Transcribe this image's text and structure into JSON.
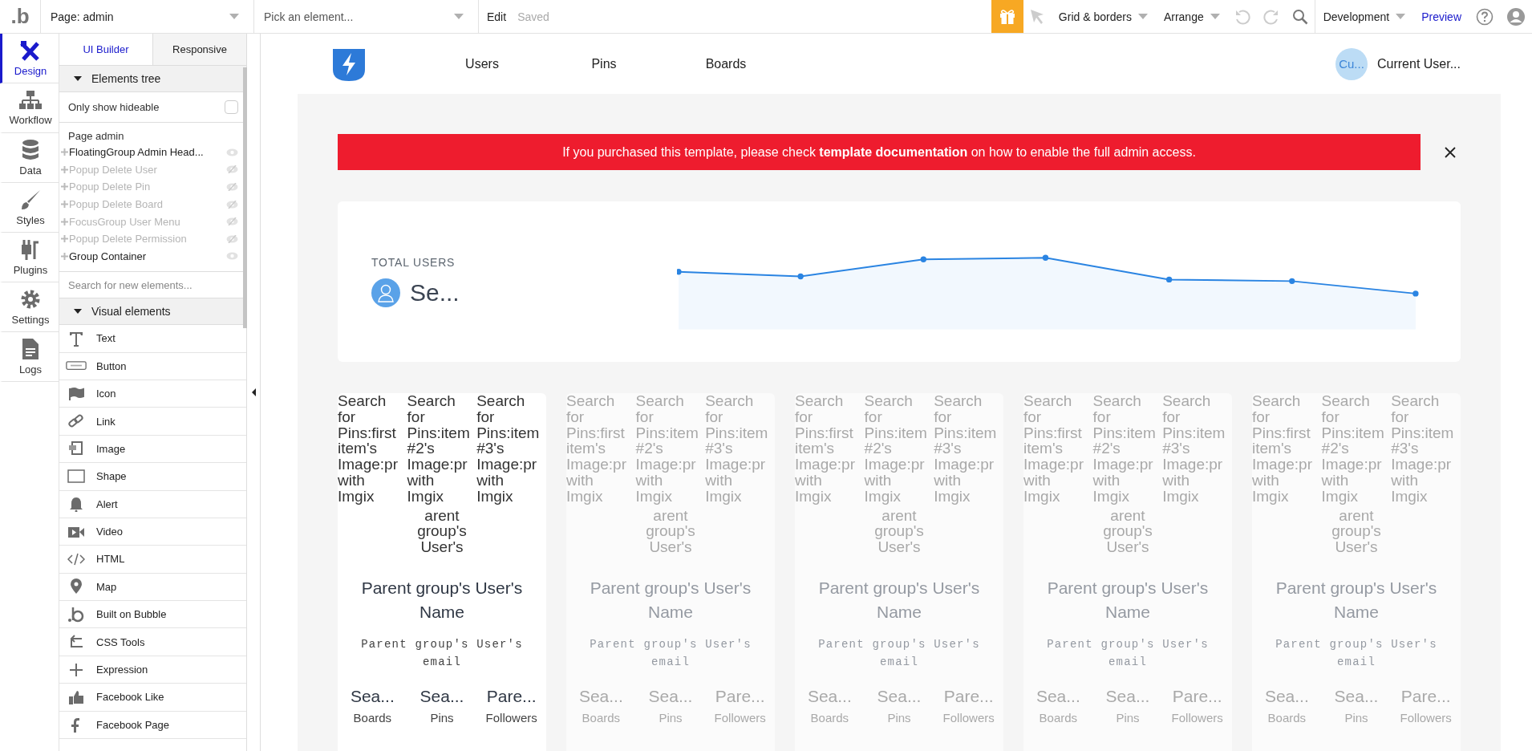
{
  "topbar": {
    "logo": ".b",
    "page_select": "Page: admin",
    "element_select": {
      "placeholder": "Pick an element..."
    },
    "edit": "Edit",
    "status": "Saved",
    "grid": "Grid & borders",
    "arrange": "Arrange",
    "mode": "Development",
    "preview": "Preview"
  },
  "rail": [
    {
      "label": "Design",
      "kind": "design",
      "selected": true
    },
    {
      "label": "Workflow",
      "kind": "workflow",
      "selected": false
    },
    {
      "label": "Data",
      "kind": "data",
      "selected": false
    },
    {
      "label": "Styles",
      "kind": "styles",
      "selected": false
    },
    {
      "label": "Plugins",
      "kind": "plugins",
      "selected": false
    },
    {
      "label": "Settings",
      "kind": "settings",
      "selected": false
    },
    {
      "label": "Logs",
      "kind": "logs",
      "selected": false
    }
  ],
  "panel_tabs": [
    {
      "label": "UI Builder",
      "selected": true
    },
    {
      "label": "Responsive",
      "selected": false
    }
  ],
  "elements_tree": {
    "title": "Elements tree",
    "expanded": true,
    "only_hideable": {
      "label": "Only show hideable",
      "checked": false
    },
    "root": "Page admin",
    "items": [
      {
        "label": "FloatingGroup Admin Head...",
        "visible": true
      },
      {
        "label": "Popup Delete User",
        "visible": false
      },
      {
        "label": "Popup Delete Pin",
        "visible": false
      },
      {
        "label": "Popup Delete Board",
        "visible": false
      },
      {
        "label": "FocusGroup User Menu",
        "visible": false
      },
      {
        "label": "Popup Delete Permission",
        "visible": false
      },
      {
        "label": "Group Container",
        "visible": true
      }
    ]
  },
  "search": {
    "placeholder": "Search for new elements..."
  },
  "visual_elements": {
    "title": "Visual elements",
    "expanded": true,
    "items": [
      {
        "label": "Text",
        "kind": "text"
      },
      {
        "label": "Button",
        "kind": "button"
      },
      {
        "label": "Icon",
        "kind": "icon"
      },
      {
        "label": "Link",
        "kind": "link"
      },
      {
        "label": "Image",
        "kind": "image"
      },
      {
        "label": "Shape",
        "kind": "shape"
      },
      {
        "label": "Alert",
        "kind": "alert"
      },
      {
        "label": "Video",
        "kind": "video"
      },
      {
        "label": "HTML",
        "kind": "html"
      },
      {
        "label": "Map",
        "kind": "map"
      },
      {
        "label": "Built on Bubble",
        "kind": "bubble"
      },
      {
        "label": "CSS Tools",
        "kind": "css"
      },
      {
        "label": "Expression",
        "kind": "expression"
      },
      {
        "label": "Facebook Like",
        "kind": "like"
      },
      {
        "label": "Facebook Page",
        "kind": "facebook"
      }
    ]
  },
  "page": {
    "nav": [
      "Users",
      "Pins",
      "Boards"
    ],
    "user": {
      "avatar": "Cu...",
      "name": "Current User..."
    },
    "banner": {
      "text": "If you purchased this template, please check **template documentation** on how to enable the full admin access."
    },
    "stat": {
      "label": "TOTAL USERS",
      "value": "Se..."
    },
    "cards": [
      {
        "faded": false,
        "image_texts": [
          "Search for Pins:first item's Image:pr with Imgix",
          "Search for Pins:item #2's Image:pr with Imgix",
          "Search for Pins:item #3's Image:pr with Imgix"
        ],
        "avatar_text": "arent group's User's",
        "name": "Parent group's User's Name",
        "email": "Parent group's User's email",
        "stats": [
          {
            "value": "Sea...",
            "label": "Boards"
          },
          {
            "value": "Sea...",
            "label": "Pins"
          },
          {
            "value": "Pare...",
            "label": "Followers"
          }
        ]
      },
      {
        "faded": true,
        "image_texts": [
          "Search for Pins:first item's Image:pr with Imgix",
          "Search for Pins:item #2's Image:pr with Imgix",
          "Search for Pins:item #3's Image:pr with Imgix"
        ],
        "avatar_text": "arent group's User's",
        "name": "Parent group's User's Name",
        "email": "Parent group's User's email",
        "stats": [
          {
            "value": "Sea...",
            "label": "Boards"
          },
          {
            "value": "Sea...",
            "label": "Pins"
          },
          {
            "value": "Pare...",
            "label": "Followers"
          }
        ]
      },
      {
        "faded": true,
        "image_texts": [
          "Search for Pins:first item's Image:pr with Imgix",
          "Search for Pins:item #2's Image:pr with Imgix",
          "Search for Pins:item #3's Image:pr with Imgix"
        ],
        "avatar_text": "arent group's User's",
        "name": "Parent group's User's Name",
        "email": "Parent group's User's email",
        "stats": [
          {
            "value": "Sea...",
            "label": "Boards"
          },
          {
            "value": "Sea...",
            "label": "Pins"
          },
          {
            "value": "Pare...",
            "label": "Followers"
          }
        ]
      },
      {
        "faded": true,
        "image_texts": [
          "Search for Pins:first item's Image:pr with Imgix",
          "Search for Pins:item #2's Image:pr with Imgix",
          "Search for Pins:item #3's Image:pr with Imgix"
        ],
        "avatar_text": "arent group's User's",
        "name": "Parent group's User's Name",
        "email": "Parent group's User's email",
        "stats": [
          {
            "value": "Sea...",
            "label": "Boards"
          },
          {
            "value": "Sea...",
            "label": "Pins"
          },
          {
            "value": "Pare...",
            "label": "Followers"
          }
        ]
      },
      {
        "faded": true,
        "image_texts": [
          "Search for Pins:first item's Image:pr with Imgix",
          "Search for Pins:item #2's Image:pr with Imgix",
          "Search for Pins:item #3's Image:pr with Imgix"
        ],
        "avatar_text": "arent group's User's",
        "name": "Parent group's User's Name",
        "email": "Parent group's User's email",
        "stats": [
          {
            "value": "Sea...",
            "label": "Boards"
          },
          {
            "value": "Sea...",
            "label": "Pins"
          },
          {
            "value": "Pare...",
            "label": "Followers"
          }
        ]
      }
    ]
  }
}
